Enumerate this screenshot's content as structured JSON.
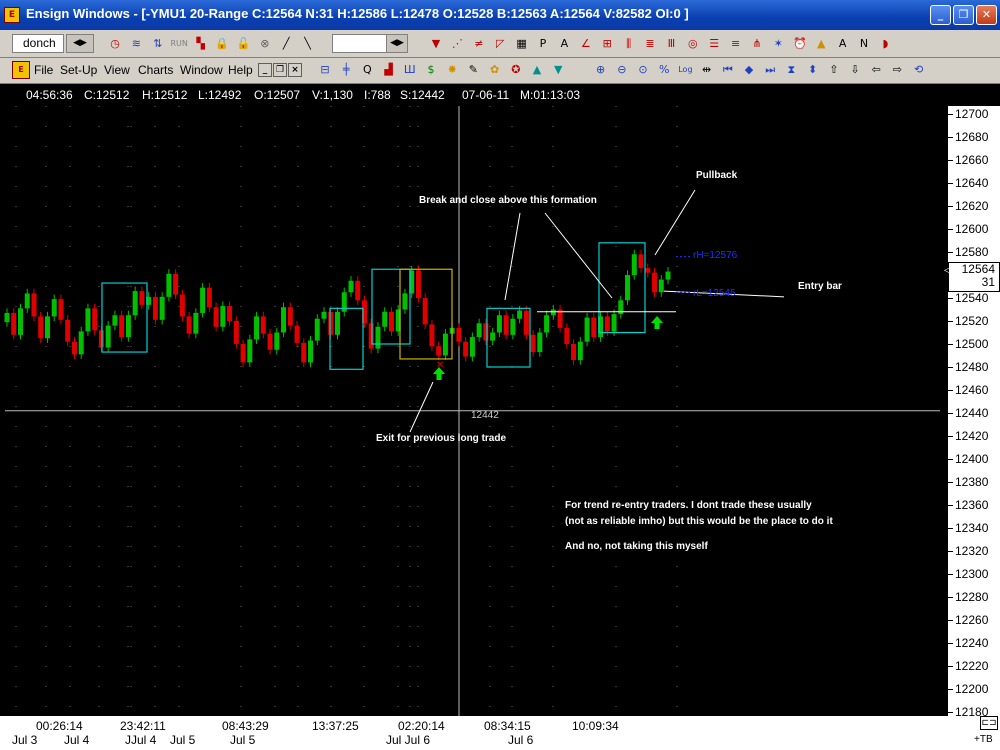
{
  "window": {
    "app_icon_label": "E",
    "title": "Ensign Windows - [-YMU1 20-Range C:12564 N:31 H:12586 L:12478 O:12528 B:12563 A:12564 V:82582 OI:0 ]",
    "buttons": [
      "_",
      "❐",
      "✕"
    ]
  },
  "toolbar1": {
    "template_name": "donch",
    "icons": [
      {
        "name": "clock-icon",
        "glyph": "◷",
        "color": "#c00000"
      },
      {
        "name": "wave-icon",
        "glyph": "≋",
        "color": "#2040c0"
      },
      {
        "name": "up-down-arrows-icon",
        "glyph": "⇅",
        "color": "#2040c0"
      },
      {
        "name": "run-icon",
        "glyph": "RUN",
        "color": "#808080"
      },
      {
        "name": "palette-icon",
        "glyph": "▚",
        "color": "#c00000"
      },
      {
        "name": "lock-icon",
        "glyph": "🔒",
        "color": "#606060"
      },
      {
        "name": "unlock-icon",
        "glyph": "🔓",
        "color": "#606060"
      },
      {
        "name": "clear-icon",
        "glyph": "⊗",
        "color": "#606060"
      },
      {
        "name": "line-tool-icon",
        "glyph": "╱",
        "color": "#000000"
      },
      {
        "name": "diagonal-tool-icon",
        "glyph": "╲",
        "color": "#000000"
      },
      {
        "name": "arrow-down-icon",
        "glyph": "▼",
        "color": "#c00000"
      },
      {
        "name": "fib-fan-icon",
        "glyph": "⋰",
        "color": "#c00000"
      },
      {
        "name": "retrace-icon",
        "glyph": "≠",
        "color": "#c00000"
      },
      {
        "name": "speed-line-icon",
        "glyph": "◸",
        "color": "#c00000"
      },
      {
        "name": "grid-icon",
        "glyph": "▦",
        "color": "#000000"
      },
      {
        "name": "text-p-icon",
        "glyph": "P",
        "color": "#000000"
      },
      {
        "name": "text-a-icon",
        "glyph": "A",
        "color": "#000000"
      },
      {
        "name": "angle-icon",
        "glyph": "∠",
        "color": "#c00000"
      },
      {
        "name": "sub-icon",
        "glyph": "⊞",
        "color": "#c00000"
      },
      {
        "name": "channel-icon",
        "glyph": "⫼",
        "color": "#c00000"
      },
      {
        "name": "fib-lines-icon",
        "glyph": "≣",
        "color": "#c00000"
      },
      {
        "name": "bars-icon",
        "glyph": "Ⅲ",
        "color": "#c00000"
      },
      {
        "name": "circle-icon",
        "glyph": "◎",
        "color": "#c00000"
      },
      {
        "name": "horizontal-lines-icon",
        "glyph": "☰",
        "color": "#c00000"
      },
      {
        "name": "equal-icon",
        "glyph": "≡",
        "color": "#c00000"
      },
      {
        "name": "pitchfork-icon",
        "glyph": "⋔",
        "color": "#c00000"
      },
      {
        "name": "spark-icon",
        "glyph": "✶",
        "color": "#2040c0"
      },
      {
        "name": "alarm-icon",
        "glyph": "⏰",
        "color": "#c00000"
      },
      {
        "name": "triangle-icon",
        "glyph": "▲",
        "color": "#d09000"
      },
      {
        "name": "text-tool-icon",
        "glyph": "A",
        "color": "#000000"
      },
      {
        "name": "note-icon",
        "glyph": "N",
        "color": "#000000"
      },
      {
        "name": "magnet-icon",
        "glyph": "◗",
        "color": "#c00000"
      }
    ]
  },
  "menu": {
    "items": [
      "File",
      "Set-Up",
      "View",
      "Charts",
      "Window",
      "Help"
    ],
    "mdi_buttons": [
      "_",
      "❐",
      "×"
    ],
    "icons": [
      {
        "name": "layout-icon",
        "glyph": "⊟",
        "color": "#2040c0"
      },
      {
        "name": "histogram-icon",
        "glyph": "╪",
        "color": "#2040c0"
      },
      {
        "name": "quote-icon",
        "glyph": "Q",
        "color": "#000000"
      },
      {
        "name": "fire-chart-icon",
        "glyph": "▟",
        "color": "#c00000"
      },
      {
        "name": "index-icon",
        "glyph": "Ш",
        "color": "#2040c0"
      },
      {
        "name": "dollar-icon",
        "glyph": "$",
        "color": "#008000"
      },
      {
        "name": "star-icon",
        "glyph": "✸",
        "color": "#d09000"
      },
      {
        "name": "notepad-icon",
        "glyph": "✎",
        "color": "#000000"
      },
      {
        "name": "palette-icon",
        "glyph": "✿",
        "color": "#d09000"
      },
      {
        "name": "color-wheel-icon",
        "glyph": "✪",
        "color": "#c00000"
      },
      {
        "name": "up-triangle-icon",
        "glyph": "▲",
        "color": "#009090"
      },
      {
        "name": "down-triangle-icon",
        "glyph": "▼",
        "color": "#009090"
      },
      {
        "name": "zoom-in-icon",
        "glyph": "⊕",
        "color": "#2040c0"
      },
      {
        "name": "zoom-out-icon",
        "glyph": "⊖",
        "color": "#2040c0"
      },
      {
        "name": "zoom-fit-icon",
        "glyph": "⊙",
        "color": "#2040c0"
      },
      {
        "name": "percent-icon",
        "glyph": "%",
        "color": "#2040c0"
      },
      {
        "name": "log-icon",
        "glyph": "Log",
        "color": "#2040c0"
      },
      {
        "name": "compress-icon",
        "glyph": "⇹",
        "color": "#000000"
      },
      {
        "name": "first-icon",
        "glyph": "⏮",
        "color": "#2040c0"
      },
      {
        "name": "diamond-icon",
        "glyph": "◆",
        "color": "#2040c0"
      },
      {
        "name": "last-icon",
        "glyph": "⏭",
        "color": "#2040c0"
      },
      {
        "name": "hourglass-icon",
        "glyph": "⧗",
        "color": "#2040c0"
      },
      {
        "name": "up-down-icon",
        "glyph": "⬍",
        "color": "#2040c0"
      },
      {
        "name": "arrow-up-icon",
        "glyph": "⇧",
        "color": "#000000"
      },
      {
        "name": "arrow-down-icon",
        "glyph": "⇩",
        "color": "#000000"
      },
      {
        "name": "arrow-left-icon",
        "glyph": "⇦",
        "color": "#000000"
      },
      {
        "name": "arrow-right-icon",
        "glyph": "⇨",
        "color": "#000000"
      },
      {
        "name": "reset-icon",
        "glyph": "⟲",
        "color": "#2040c0"
      }
    ]
  },
  "status": {
    "time": "04:56:36",
    "close": "C:12512",
    "high": "H:12512",
    "low": "L:12492",
    "open": "O:12507",
    "volume": "V:1,130",
    "interval": "I:788",
    "s_value": "S:12442",
    "date": "07-06-11",
    "m_value": "M:01:13:03"
  },
  "chart_data": {
    "type": "candlestick",
    "symbol": "-YMU1 20-Range",
    "y_axis": {
      "range": [
        12175,
        12710
      ],
      "ticks": [
        12700,
        12680,
        12660,
        12640,
        12620,
        12600,
        12580,
        12560,
        12540,
        12520,
        12500,
        12480,
        12460,
        12440,
        12420,
        12400,
        12380,
        12360,
        12340,
        12320,
        12300,
        12280,
        12260,
        12240,
        12220,
        12200,
        12180
      ]
    },
    "last_price": "12564",
    "bars_count": "31",
    "crosshair_price": "12442",
    "x_times": [
      {
        "label": "00:26:14"
      },
      {
        "label": "23:42:11"
      },
      {
        "label": "08:43:29"
      },
      {
        "label": "13:37:25"
      },
      {
        "label": "02:20:14"
      },
      {
        "label": "08:34:15"
      },
      {
        "label": "10:09:34"
      }
    ],
    "x_dates": [
      {
        "label": "Jul 3"
      },
      {
        "label": "Jul 4"
      },
      {
        "label": "JJul 4"
      },
      {
        "label": "Jul 5"
      },
      {
        "label": "Jul 5"
      },
      {
        "label": "Jul Jul 6"
      },
      {
        "label": "Jul 6"
      }
    ],
    "candles": [
      {
        "o": 12519,
        "c": 12527
      },
      {
        "o": 12527,
        "c": 12508
      },
      {
        "o": 12508,
        "c": 12531
      },
      {
        "o": 12531,
        "c": 12544
      },
      {
        "o": 12544,
        "c": 12524
      },
      {
        "o": 12524,
        "c": 12505
      },
      {
        "o": 12505,
        "c": 12524
      },
      {
        "o": 12524,
        "c": 12539
      },
      {
        "o": 12539,
        "c": 12521
      },
      {
        "o": 12521,
        "c": 12502
      },
      {
        "o": 12502,
        "c": 12491
      },
      {
        "o": 12491,
        "c": 12511
      },
      {
        "o": 12511,
        "c": 12531
      },
      {
        "o": 12531,
        "c": 12512
      },
      {
        "o": 12512,
        "c": 12497
      },
      {
        "o": 12497,
        "c": 12516
      },
      {
        "o": 12516,
        "c": 12525
      },
      {
        "o": 12525,
        "c": 12506
      },
      {
        "o": 12506,
        "c": 12525
      },
      {
        "o": 12525,
        "c": 12546
      },
      {
        "o": 12546,
        "c": 12534
      },
      {
        "o": 12534,
        "c": 12541
      },
      {
        "o": 12541,
        "c": 12521
      },
      {
        "o": 12521,
        "c": 12541
      },
      {
        "o": 12541,
        "c": 12561
      },
      {
        "o": 12561,
        "c": 12543
      },
      {
        "o": 12543,
        "c": 12524
      },
      {
        "o": 12524,
        "c": 12509
      },
      {
        "o": 12509,
        "c": 12527
      },
      {
        "o": 12527,
        "c": 12549
      },
      {
        "o": 12549,
        "c": 12532
      },
      {
        "o": 12532,
        "c": 12515
      },
      {
        "o": 12515,
        "c": 12533
      },
      {
        "o": 12533,
        "c": 12520
      },
      {
        "o": 12520,
        "c": 12500
      },
      {
        "o": 12500,
        "c": 12484
      },
      {
        "o": 12484,
        "c": 12504
      },
      {
        "o": 12504,
        "c": 12524
      },
      {
        "o": 12524,
        "c": 12509
      },
      {
        "o": 12509,
        "c": 12495
      },
      {
        "o": 12495,
        "c": 12510
      },
      {
        "o": 12510,
        "c": 12532
      },
      {
        "o": 12532,
        "c": 12516
      },
      {
        "o": 12516,
        "c": 12501
      },
      {
        "o": 12501,
        "c": 12484
      },
      {
        "o": 12484,
        "c": 12503
      },
      {
        "o": 12503,
        "c": 12522
      },
      {
        "o": 12522,
        "c": 12528
      },
      {
        "o": 12528,
        "c": 12508
      },
      {
        "o": 12508,
        "c": 12528
      },
      {
        "o": 12528,
        "c": 12545
      },
      {
        "o": 12545,
        "c": 12555
      },
      {
        "o": 12555,
        "c": 12538
      },
      {
        "o": 12538,
        "c": 12518
      },
      {
        "o": 12518,
        "c": 12496
      },
      {
        "o": 12496,
        "c": 12515
      },
      {
        "o": 12515,
        "c": 12528
      },
      {
        "o": 12528,
        "c": 12511
      },
      {
        "o": 12511,
        "c": 12530
      },
      {
        "o": 12530,
        "c": 12544
      },
      {
        "o": 12544,
        "c": 12564
      },
      {
        "o": 12564,
        "c": 12540
      },
      {
        "o": 12540,
        "c": 12517
      },
      {
        "o": 12517,
        "c": 12498
      },
      {
        "o": 12498,
        "c": 12490
      },
      {
        "o": 12490,
        "c": 12509
      },
      {
        "o": 12509,
        "c": 12514
      },
      {
        "o": 12514,
        "c": 12502
      },
      {
        "o": 12502,
        "c": 12489
      },
      {
        "o": 12489,
        "c": 12506
      },
      {
        "o": 12506,
        "c": 12518
      },
      {
        "o": 12518,
        "c": 12503
      },
      {
        "o": 12503,
        "c": 12510
      },
      {
        "o": 12510,
        "c": 12525
      },
      {
        "o": 12525,
        "c": 12508
      },
      {
        "o": 12508,
        "c": 12522
      },
      {
        "o": 12522,
        "c": 12529
      },
      {
        "o": 12529,
        "c": 12508
      },
      {
        "o": 12508,
        "c": 12493
      },
      {
        "o": 12493,
        "c": 12510
      },
      {
        "o": 12510,
        "c": 12525
      },
      {
        "o": 12525,
        "c": 12530
      },
      {
        "o": 12530,
        "c": 12514
      },
      {
        "o": 12514,
        "c": 12500
      },
      {
        "o": 12500,
        "c": 12486
      },
      {
        "o": 12486,
        "c": 12502
      },
      {
        "o": 12502,
        "c": 12523
      },
      {
        "o": 12523,
        "c": 12506
      },
      {
        "o": 12506,
        "c": 12524
      },
      {
        "o": 12524,
        "c": 12511
      },
      {
        "o": 12511,
        "c": 12526
      },
      {
        "o": 12526,
        "c": 12538
      },
      {
        "o": 12538,
        "c": 12560
      },
      {
        "o": 12560,
        "c": 12578
      },
      {
        "o": 12578,
        "c": 12566
      },
      {
        "o": 12566,
        "c": 12562
      },
      {
        "o": 12562,
        "c": 12545
      },
      {
        "o": 12545,
        "c": 12556
      },
      {
        "o": 12556,
        "c": 12563
      }
    ],
    "levels": {
      "resistance_label": "rH=12576",
      "support_label": "rL=12545"
    },
    "annotations": {
      "pullback": "Pullback",
      "breakout": "Break and close above this formation",
      "entry_bar": "Entry bar",
      "exit": "Exit for previous long trade",
      "note1": "For trend re-entry traders. I dont trade these usually",
      "note2": "(not as reliable imho) but this would be the place to do it",
      "note3": "And no, not taking this myself"
    },
    "colors": {
      "up": "#00c000",
      "down": "#e00000",
      "box": "#00d0d0",
      "exit_box": "#c8b400",
      "signal": "#00e000",
      "level_label": "#1e30ff"
    },
    "grid": true
  },
  "corner": {
    "scroll_glyph": "⊏⊐",
    "tb_label": "+TB"
  }
}
